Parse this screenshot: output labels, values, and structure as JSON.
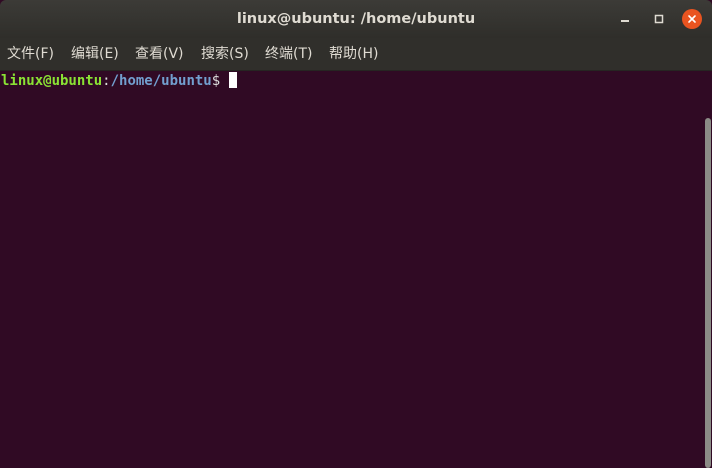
{
  "window": {
    "title": "linux@ubuntu: /home/ubuntu",
    "accent_close": "#e95420",
    "buttons": [
      "minimize-icon",
      "maximize-icon",
      "close-icon"
    ]
  },
  "menubar": {
    "items": [
      {
        "label": "文件(F)"
      },
      {
        "label": "编辑(E)"
      },
      {
        "label": "查看(V)"
      },
      {
        "label": "搜索(S)"
      },
      {
        "label": "终端(T)"
      },
      {
        "label": "帮助(H)"
      }
    ]
  },
  "terminal": {
    "user_host": "linux@ubuntu",
    "colon": ":",
    "path": "/home/ubuntu",
    "dollar": "$",
    "background": "#300a24",
    "user_color": "#8ae234",
    "path_color": "#729fcf"
  }
}
